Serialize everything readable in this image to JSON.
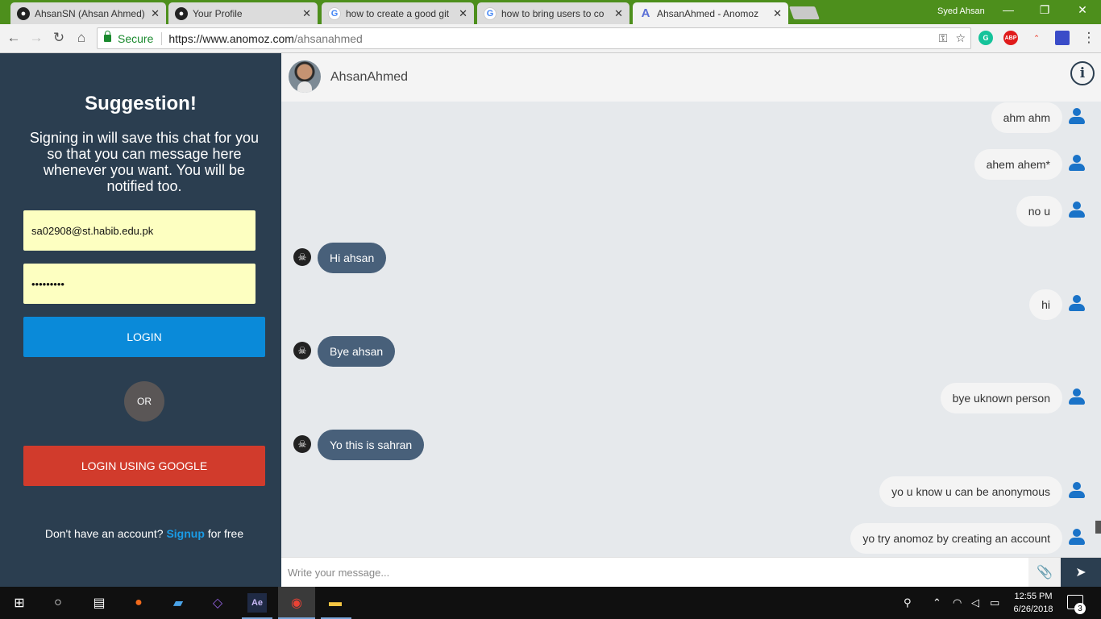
{
  "browser": {
    "tabs": [
      {
        "title": "AhsanSN (Ahsan Ahmed)",
        "favicon": "github-icon",
        "active": false
      },
      {
        "title": "Your Profile",
        "favicon": "github-icon",
        "active": false
      },
      {
        "title": "how to create a good git",
        "favicon": "google-icon",
        "active": false
      },
      {
        "title": "how to bring users to co",
        "favicon": "google-icon",
        "active": false
      },
      {
        "title": "AhsanAhmed - Anomoz",
        "favicon": "anomoz-icon",
        "active": true
      }
    ],
    "window_user": "Syed Ahsan",
    "secure_label": "Secure",
    "url_origin": "https://www.anomoz.com",
    "url_path": "/ahsanahmed",
    "extensions": [
      "G",
      "ABP",
      "",
      ""
    ]
  },
  "left_panel": {
    "title": "Suggestion!",
    "message": "Signing in will save this chat for you so that you can message here whenever you want. You will be notified too.",
    "email_value": "sa02908@st.habib.edu.pk",
    "password_masked": "•••••••••",
    "login_label": "LOGIN",
    "or_label": "OR",
    "google_login_label": "LOGIN USING GOOGLE",
    "signup_prefix": "Don't have an account?",
    "signup_link": "Signup",
    "signup_suffix": "for free",
    "colors": {
      "panel": "#2b3e50",
      "login": "#0a8ad9",
      "google": "#d13b2c",
      "input_bg": "#fdffc1"
    }
  },
  "chat": {
    "name": "AhsanAhmed",
    "messages": [
      {
        "text": "ahm ahm",
        "direction": "outgoing"
      },
      {
        "text": "ahem ahem*",
        "direction": "outgoing"
      },
      {
        "text": "no u",
        "direction": "outgoing"
      },
      {
        "text": "Hi ahsan",
        "direction": "incoming"
      },
      {
        "text": "hi",
        "direction": "outgoing"
      },
      {
        "text": "Bye ahsan",
        "direction": "incoming"
      },
      {
        "text": "bye uknown person",
        "direction": "outgoing"
      },
      {
        "text": "Yo this is sahran",
        "direction": "incoming"
      },
      {
        "text": "yo u know u can be anonymous",
        "direction": "outgoing"
      },
      {
        "text": "yo try anomoz by creating an account",
        "direction": "outgoing"
      }
    ],
    "composer_placeholder": "Write your message...",
    "colors": {
      "incoming_bubble": "#48607a",
      "outgoing_bubble": "#f4f4f4",
      "user_icon": "#1a73c8"
    }
  },
  "taskbar": {
    "time": "12:55 PM",
    "date": "6/26/2018",
    "notification_count": "3"
  }
}
